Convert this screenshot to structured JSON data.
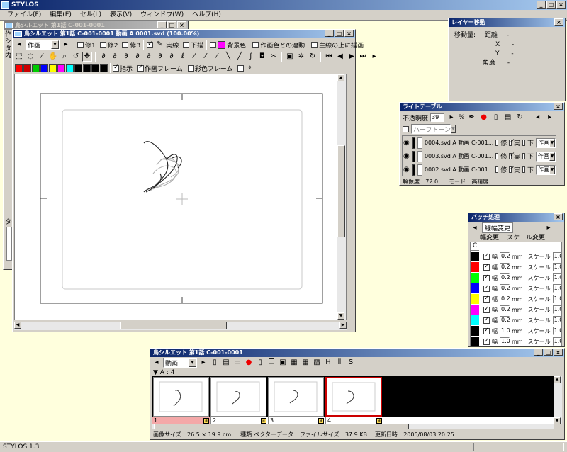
{
  "app": {
    "title": "STYLOS",
    "status": "STYLOS 1.3",
    "menu": [
      "ファイル(F)",
      "編集(E)",
      "セル(L)",
      "表示(V)",
      "ウィンドウ(W)",
      "ヘルプ(H)"
    ]
  },
  "bg_window": {
    "title": "鳥シルエット 第1話 C-001-0001",
    "side_labels": [
      "作",
      "シ",
      "タ",
      "内"
    ],
    "lower_label": "タイ"
  },
  "drawing_window": {
    "title": "鳥シルエット 第1話 C-001-0001 動画 A 0001.svd (100.00%)",
    "mode_combo": "作画",
    "ref_buttons": [
      "修1",
      "修2",
      "修3"
    ],
    "layer_toggles": [
      "実線",
      "下描"
    ],
    "bg_color_label": "背景色",
    "link_label": "作画色との連動",
    "overlay_label": "主線の上に描画",
    "bottom_options": [
      "指示",
      "作画フレーム",
      "彩色フレーム"
    ],
    "palette": [
      "#ff0000",
      "#cc0000",
      "#00cc00",
      "#0000ff",
      "#ffff00",
      "#ff00ff",
      "#00ffff",
      "#000000",
      "#000000",
      "#000000",
      "#000000"
    ],
    "bg_color": "#ff00ff"
  },
  "layer_move": {
    "title": "レイヤー移動",
    "move_label": "移動量:",
    "distance_label": "距離",
    "x_label": "X",
    "y_label": "Y",
    "angle_label": "角度",
    "distance": "-",
    "x": "-",
    "y": "-",
    "angle": "-"
  },
  "light_table": {
    "title": "ライトテーブル",
    "opacity_label": "不透明度",
    "opacity": "39",
    "pct": "%",
    "halftone": "ハーフトーン",
    "rows": [
      {
        "file": "0004.svd A 動画 C-001...",
        "fix": "修",
        "real": "実",
        "down": "下",
        "mode": "作画"
      },
      {
        "file": "0003.svd A 動画 C-001...",
        "fix": "修",
        "real": "実",
        "down": "下",
        "mode": "作画"
      },
      {
        "file": "0002.svd A 動画 C-001...",
        "fix": "修",
        "real": "実",
        "down": "下",
        "mode": "作画"
      }
    ],
    "resolution_label": "解像度 :",
    "resolution": "72.0",
    "mode_label": "モード :",
    "mode": "高精度"
  },
  "batch": {
    "title": "バッチ処理",
    "tab": "線幅変更",
    "width_change": "幅変更",
    "scale_change": "スケール変更",
    "col_c": "C",
    "width_label": "幅",
    "unit": "mm",
    "scale_label": "スケール",
    "rows": [
      {
        "color": "#000000",
        "width": "0.2",
        "scale": "1.0"
      },
      {
        "color": "#ff0000",
        "width": "0.2",
        "scale": "1.0"
      },
      {
        "color": "#00ff00",
        "width": "0.2",
        "scale": "1.0"
      },
      {
        "color": "#0000ff",
        "width": "0.2",
        "scale": "1.0"
      },
      {
        "color": "#ffff00",
        "width": "0.2",
        "scale": "1.0"
      },
      {
        "color": "#ff00ff",
        "width": "0.2",
        "scale": "1.0"
      },
      {
        "color": "#00ffff",
        "width": "0.2",
        "scale": "1.0"
      },
      {
        "color": "#000000",
        "width": "1.0",
        "scale": "1.0"
      },
      {
        "color": "#000000",
        "width": "1.0",
        "scale": "1.0"
      }
    ]
  },
  "timeline": {
    "title": "鳥シルエット 第1話 C-001-0001",
    "combo": "動画",
    "layer_label": "A : 4",
    "frames": [
      "1",
      "2",
      "3",
      "4"
    ],
    "size_label": "画像サイズ :",
    "size": "26.5 × 19.9 cm",
    "type_label": "種類",
    "type": "ベクターデータ",
    "filesize_label": "ファイルサイズ :",
    "filesize": "37.9 KB",
    "updated_label": "更新日時 :",
    "updated": "2005/08/03 20:25"
  }
}
